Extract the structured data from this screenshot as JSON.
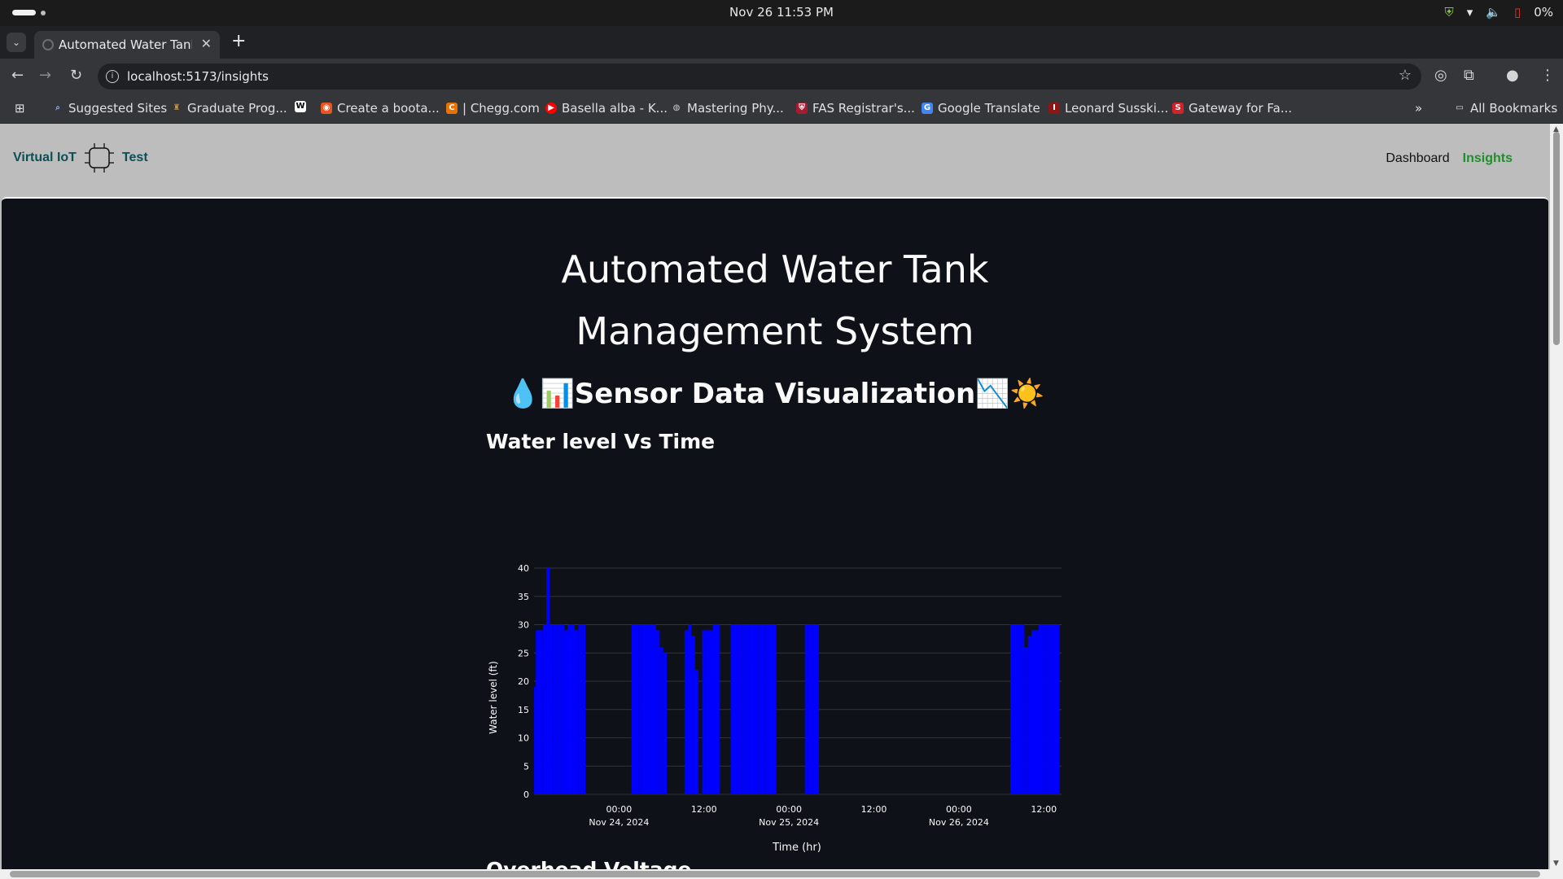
{
  "os": {
    "clock": "Nov 26  11:53 PM",
    "battery": "0%"
  },
  "browser": {
    "tab_title": "Automated Water Tank M",
    "url": "localhost:5173/insights",
    "bookmarks": [
      {
        "label": "Suggested Sites",
        "icon": "search-icon",
        "color": "#8ab4f8"
      },
      {
        "label": "Graduate Prog...",
        "icon": "graduation-icon",
        "color": "#c8954a"
      },
      {
        "label": "",
        "icon": "wikipedia-icon",
        "color": "#ffffff"
      },
      {
        "label": "Create a boota...",
        "icon": "ubuntu-icon",
        "color": "#e95420"
      },
      {
        "label": "| Chegg.com",
        "icon": "chegg-icon",
        "color": "#eb7100"
      },
      {
        "label": "Basella alba - K...",
        "icon": "youtube-icon",
        "color": "#ff0000"
      },
      {
        "label": "Mastering Phy...",
        "icon": "globe-icon",
        "color": "#cccccc"
      },
      {
        "label": "FAS Registrar's...",
        "icon": "shield-icon",
        "color": "#a51c30"
      },
      {
        "label": "Google Translate",
        "icon": "translate-icon",
        "color": "#4285f4"
      },
      {
        "label": "Leonard Susski...",
        "icon": "stanford-icon",
        "color": "#8c1515"
      },
      {
        "label": "Gateway for Fa...",
        "icon": "s-icon",
        "color": "#d2232a"
      }
    ],
    "all_bookmarks": "All Bookmarks"
  },
  "app": {
    "brand_left": "Virtual IoT",
    "brand_right": "Test",
    "nav": {
      "dashboard": "Dashboard",
      "insights": "Insights"
    },
    "title_line1": "Automated Water Tank",
    "title_line2": "Management System",
    "subtitle": "💧📊Sensor Data Visualization📉☀️",
    "section_title": "Water level Vs Time",
    "next_section_partial": "Overhead Voltage"
  },
  "chart_data": {
    "type": "bar",
    "xlabel": "Time (hr)",
    "ylabel": "Water level (ft)",
    "ylim": [
      0,
      40
    ],
    "yticks": [
      0,
      5,
      10,
      15,
      20,
      25,
      30,
      35,
      40
    ],
    "xlim": [
      "2024-11-23 12:00",
      "2024-11-26 14:30"
    ],
    "xticks": [
      {
        "t": "2024-11-24 00:00",
        "label": "00:00",
        "sublabel": "Nov 24, 2024"
      },
      {
        "t": "2024-11-24 12:00",
        "label": "12:00",
        "sublabel": ""
      },
      {
        "t": "2024-11-25 00:00",
        "label": "00:00",
        "sublabel": "Nov 25, 2024"
      },
      {
        "t": "2024-11-25 12:00",
        "label": "12:00",
        "sublabel": ""
      },
      {
        "t": "2024-11-26 00:00",
        "label": "00:00",
        "sublabel": "Nov 26, 2024"
      },
      {
        "t": "2024-11-26 12:00",
        "label": "12:00",
        "sublabel": ""
      }
    ],
    "bar_color": "#0000ff",
    "grid": true,
    "series": [
      {
        "points": [
          [
            "2024-11-23 12:00",
            19
          ],
          [
            "2024-11-23 12:30",
            29
          ],
          [
            "2024-11-23 13:00",
            29
          ],
          [
            "2024-11-23 13:30",
            30
          ],
          [
            "2024-11-23 14:00",
            40
          ],
          [
            "2024-11-23 14:30",
            30
          ],
          [
            "2024-11-23 15:00",
            30
          ],
          [
            "2024-11-23 15:30",
            30
          ],
          [
            "2024-11-23 16:00",
            30
          ],
          [
            "2024-11-23 16:30",
            29
          ],
          [
            "2024-11-23 17:00",
            30
          ],
          [
            "2024-11-23 17:30",
            30
          ],
          [
            "2024-11-23 18:00",
            29
          ],
          [
            "2024-11-23 18:30",
            30
          ],
          [
            "2024-11-23 19:00",
            30
          ],
          [
            "2024-11-24 02:00",
            30
          ],
          [
            "2024-11-24 02:30",
            30
          ],
          [
            "2024-11-24 03:00",
            30
          ],
          [
            "2024-11-24 03:30",
            30
          ],
          [
            "2024-11-24 04:00",
            30
          ],
          [
            "2024-11-24 04:30",
            30
          ],
          [
            "2024-11-24 05:00",
            30
          ],
          [
            "2024-11-24 05:30",
            29
          ],
          [
            "2024-11-24 06:00",
            26
          ],
          [
            "2024-11-24 06:30",
            25
          ],
          [
            "2024-11-24 09:30",
            29
          ],
          [
            "2024-11-24 10:00",
            30
          ],
          [
            "2024-11-24 10:30",
            28
          ],
          [
            "2024-11-24 11:00",
            22
          ],
          [
            "2024-11-24 12:00",
            29
          ],
          [
            "2024-11-24 12:30",
            29
          ],
          [
            "2024-11-24 13:00",
            29
          ],
          [
            "2024-11-24 13:30",
            30
          ],
          [
            "2024-11-24 14:00",
            30
          ],
          [
            "2024-11-24 16:00",
            30
          ],
          [
            "2024-11-24 16:30",
            30
          ],
          [
            "2024-11-24 17:00",
            30
          ],
          [
            "2024-11-24 17:30",
            30
          ],
          [
            "2024-11-24 18:00",
            30
          ],
          [
            "2024-11-24 18:30",
            30
          ],
          [
            "2024-11-24 19:00",
            30
          ],
          [
            "2024-11-24 19:30",
            30
          ],
          [
            "2024-11-24 20:00",
            30
          ],
          [
            "2024-11-24 20:30",
            30
          ],
          [
            "2024-11-24 21:00",
            30
          ],
          [
            "2024-11-24 21:30",
            30
          ],
          [
            "2024-11-24 22:00",
            30
          ],
          [
            "2024-11-25 02:30",
            30
          ],
          [
            "2024-11-25 03:00",
            30
          ],
          [
            "2024-11-25 03:30",
            30
          ],
          [
            "2024-11-25 04:00",
            30
          ],
          [
            "2024-11-26 07:30",
            30
          ],
          [
            "2024-11-26 08:00",
            30
          ],
          [
            "2024-11-26 08:30",
            30
          ],
          [
            "2024-11-26 09:00",
            30
          ],
          [
            "2024-11-26 09:30",
            26
          ],
          [
            "2024-11-26 10:00",
            28
          ],
          [
            "2024-11-26 10:30",
            29
          ],
          [
            "2024-11-26 11:00",
            29
          ],
          [
            "2024-11-26 11:30",
            30
          ],
          [
            "2024-11-26 12:00",
            30
          ],
          [
            "2024-11-26 12:30",
            30
          ],
          [
            "2024-11-26 13:00",
            30
          ],
          [
            "2024-11-26 13:30",
            30
          ],
          [
            "2024-11-26 14:00",
            30
          ]
        ]
      }
    ]
  }
}
